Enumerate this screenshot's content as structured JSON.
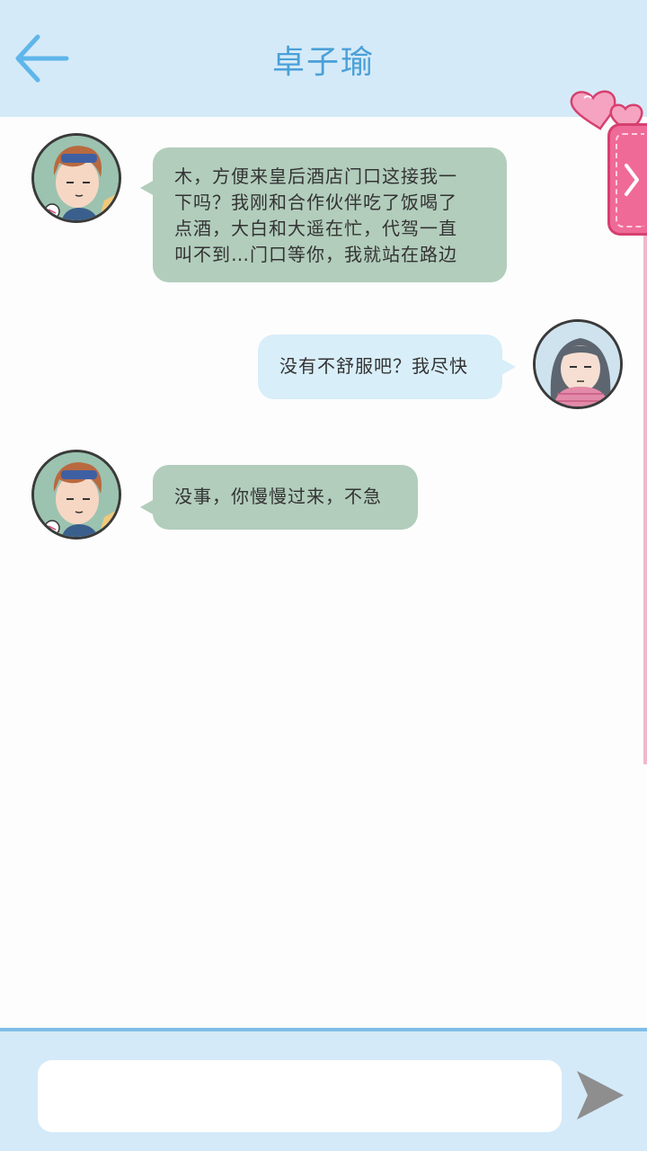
{
  "header": {
    "title": "卓子瑜",
    "back_icon": "arrow-left-icon",
    "accent_color": "#4aa0d8",
    "background_color": "#d5eaf8"
  },
  "side_tab": {
    "icon": "chevron-right-icon",
    "decoration_icon": "hearts-icon",
    "color": "#f06a97"
  },
  "messages": [
    {
      "sender": "contact",
      "direction": "incoming",
      "avatar_icon": "boy-avatar-icon",
      "lines": [
        "木，方便来皇后酒店门口这接我一",
        "下吗？我刚和合作伙伴吃了饭喝了",
        "点酒，大白和大遥在忙，代驾一直",
        "叫不到…门口等你，我就站在路边"
      ]
    },
    {
      "sender": "me",
      "direction": "outgoing",
      "avatar_icon": "girl-avatar-icon",
      "lines": [
        "没有不舒服吧？我尽快"
      ]
    },
    {
      "sender": "contact",
      "direction": "incoming",
      "avatar_icon": "boy-avatar-icon",
      "lines": [
        "没事，你慢慢过来，不急"
      ]
    }
  ],
  "composer": {
    "value": "",
    "placeholder": "",
    "send_icon": "send-icon"
  }
}
